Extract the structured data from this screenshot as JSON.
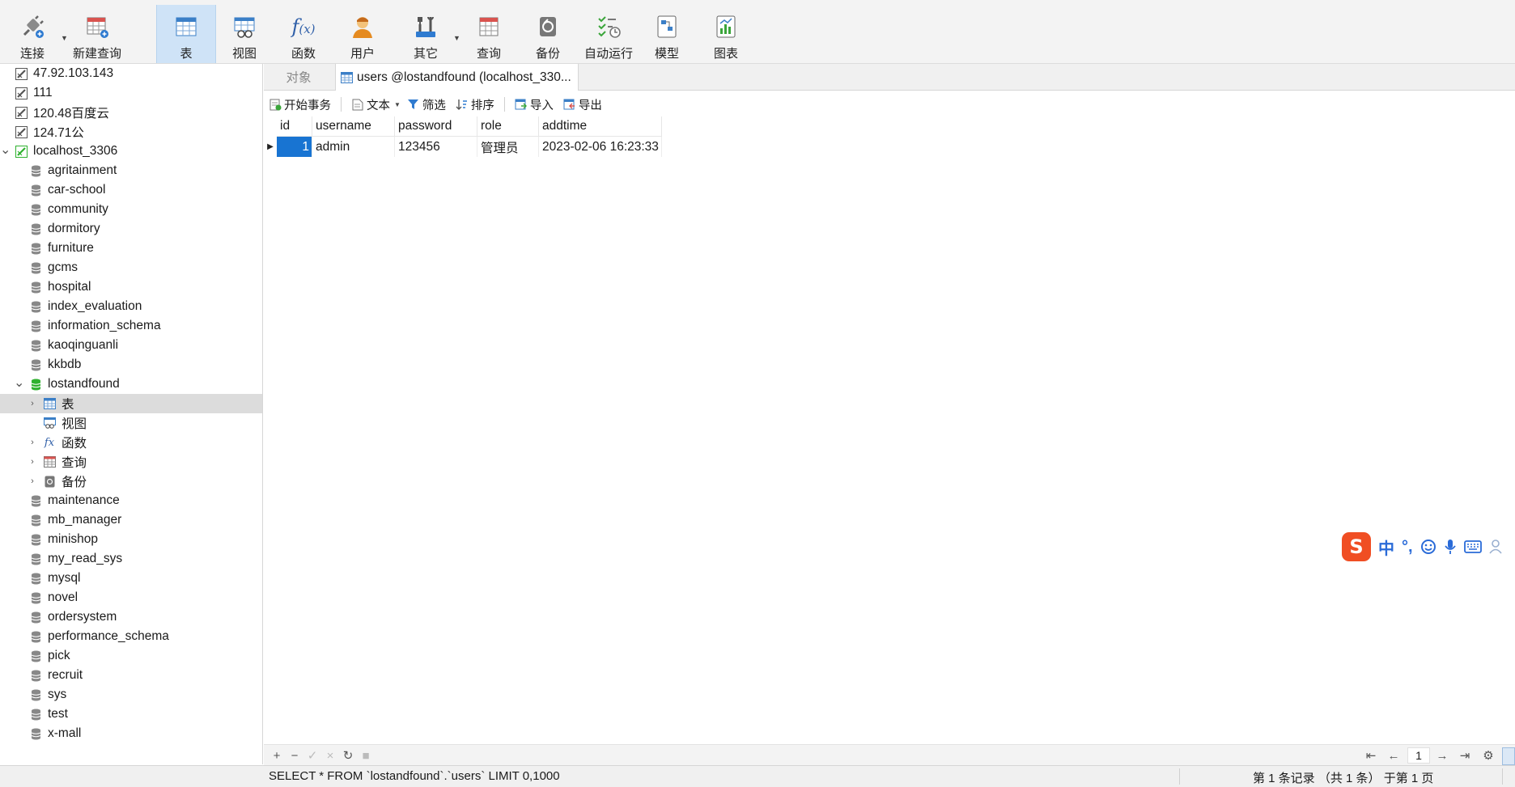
{
  "toolbar": {
    "connect": "连接",
    "new_query": "新建查询",
    "table": "表",
    "view": "视图",
    "function": "函数",
    "user": "用户",
    "other": "其它",
    "query": "查询",
    "backup": "备份",
    "automation": "自动运行",
    "model": "模型",
    "chart": "图表"
  },
  "sidebar": {
    "connections": [
      "47.92.103.143",
      "111",
      "120.48百度云",
      "124.71公"
    ],
    "active_connection": "localhost_3306",
    "databases_before": [
      "agritainment",
      "car-school",
      "community",
      "dormitory",
      "furniture",
      "gcms",
      "hospital",
      "index_evaluation",
      "information_schema",
      "kaoqinguanli",
      "kkbdb"
    ],
    "open_database": "lostandfound",
    "open_database_children": [
      "表",
      "视图",
      "函数",
      "查询",
      "备份"
    ],
    "databases_after": [
      "maintenance",
      "mb_manager",
      "minishop",
      "my_read_sys",
      "mysql",
      "novel",
      "ordersystem",
      "performance_schema",
      "pick",
      "recruit",
      "sys",
      "test",
      "x-mall"
    ]
  },
  "tabs": {
    "objects": "对象",
    "active": "users @lostandfound (localhost_330..."
  },
  "subtoolbar": {
    "begin_transaction": "开始事务",
    "text": "文本",
    "filter": "筛选",
    "sort": "排序",
    "import": "导入",
    "export": "导出"
  },
  "grid": {
    "columns": [
      "id",
      "username",
      "password",
      "role",
      "addtime"
    ],
    "rows": [
      [
        "1",
        "admin",
        "123456",
        "管理员",
        "2023-02-06 16:23:33"
      ]
    ]
  },
  "pager": {
    "page": "1"
  },
  "status": {
    "sql": "SELECT * FROM `lostandfound`.`users` LIMIT 0,1000",
    "record_info": "第 1 条记录 （共 1 条） 于第 1 页"
  },
  "ime": {
    "logo": "S",
    "lang": "中",
    "punct": "°,"
  },
  "colors": {
    "accent": "#1874d2",
    "toolbar_active": "#cfe3f7",
    "db_green": "#2fb12f",
    "ime_red": "#f04e23"
  }
}
